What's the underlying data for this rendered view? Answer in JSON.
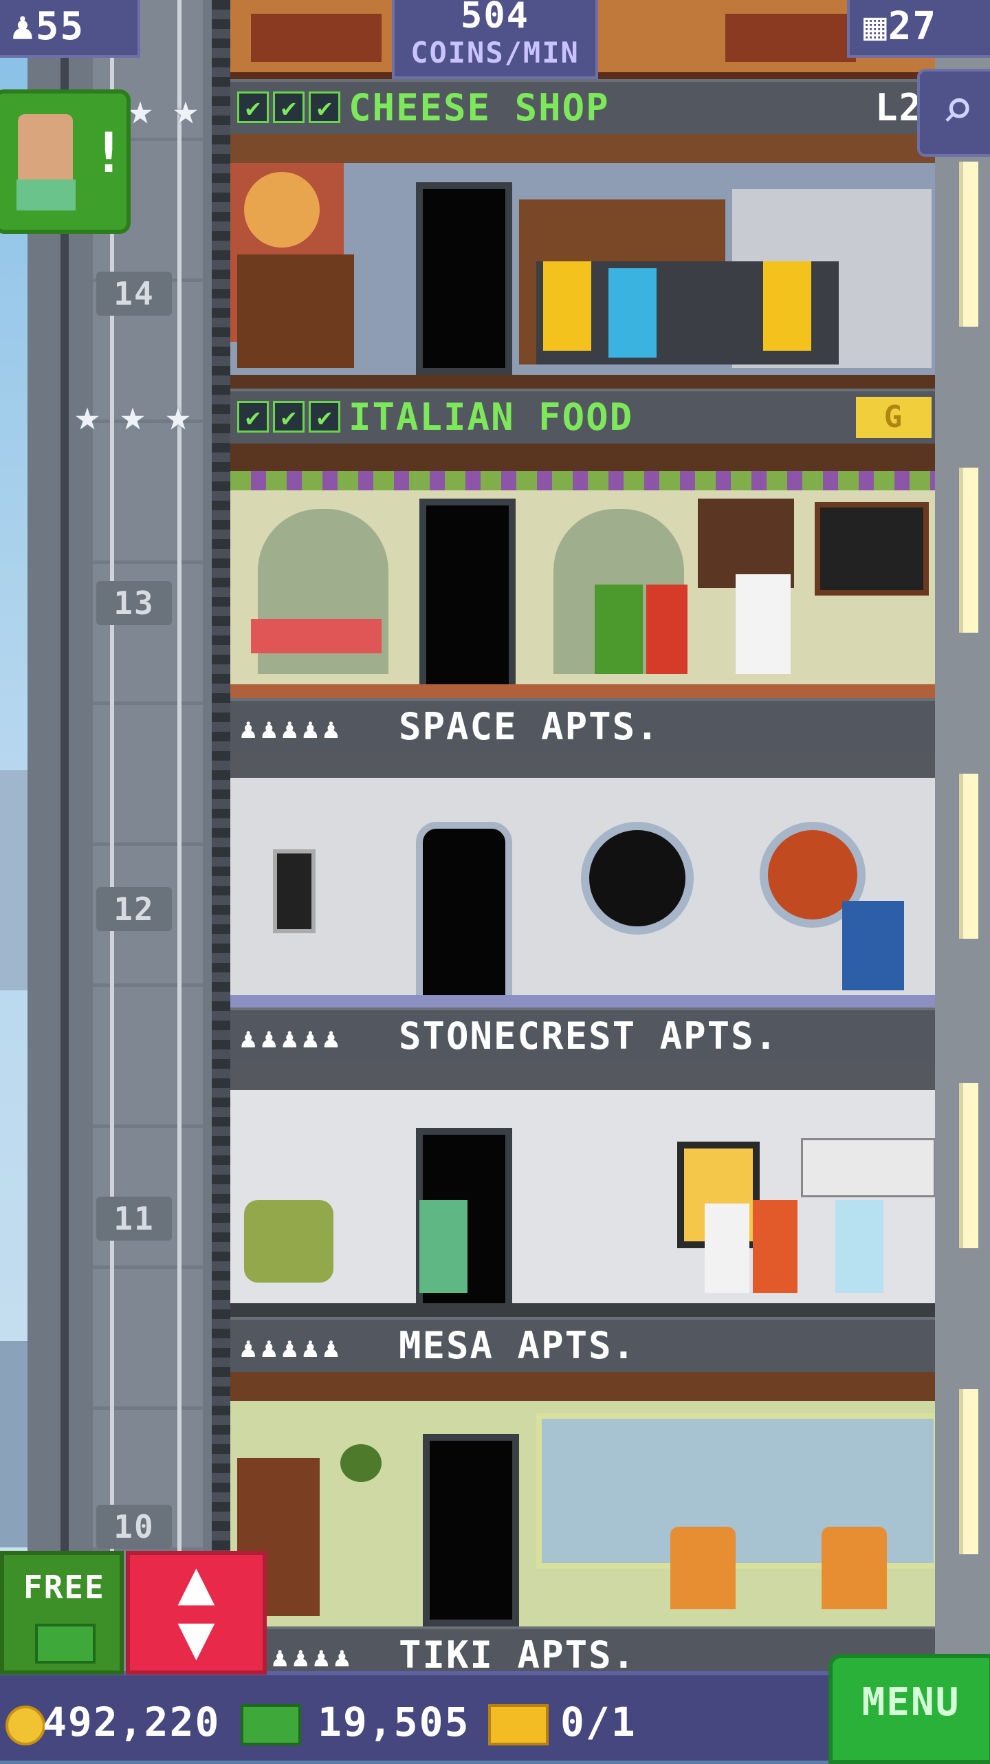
{
  "hud": {
    "population": "55",
    "coins_per_min_value": "504",
    "coins_per_min_unit": "COINS/MIN",
    "floor_count": "27",
    "zoom_icon": "magnifier-icon"
  },
  "shaft": {
    "floor_numbers": [
      "14",
      "13",
      "12",
      "11",
      "10"
    ]
  },
  "floors": {
    "cheese": {
      "name": "CHEESE SHOP",
      "level": "L2"
    },
    "italian": {
      "name": "ITALIAN FOOD",
      "badge": "G"
    },
    "space": {
      "name": "SPACE APTS."
    },
    "stonecrest": {
      "name": "STONECREST APTS."
    },
    "mesa": {
      "name": "MESA APTS."
    },
    "tiki": {
      "name": "TIKI APTS."
    }
  },
  "buttons": {
    "free_label": "FREE",
    "menu_label": "MENU",
    "elevator_icon": "up-down-arrows-icon"
  },
  "bottom_bar": {
    "coins": "492,220",
    "bux": "19,505",
    "tickets": "0/1"
  },
  "colors": {
    "hud_bg": "#50528a",
    "green_text": "#7de85a",
    "elevator_button": "#e8294a",
    "menu_button": "#29b13a"
  }
}
